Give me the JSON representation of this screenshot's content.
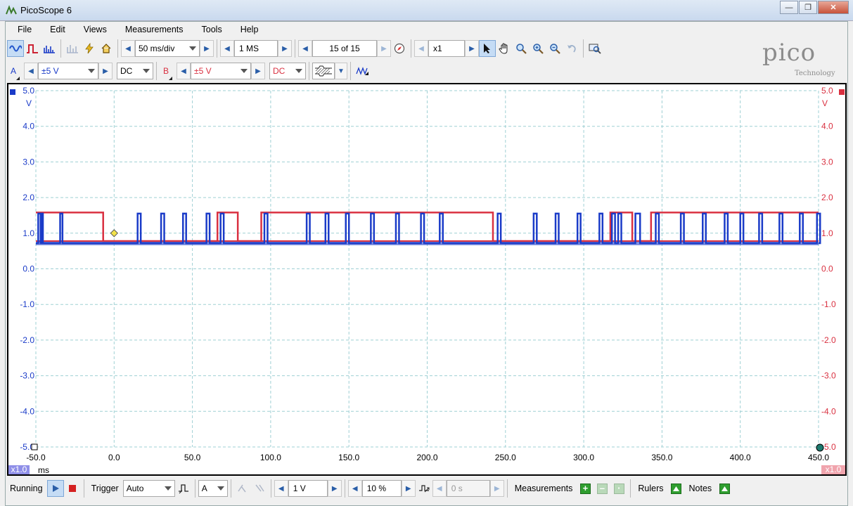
{
  "window": {
    "title": "PicoScope 6"
  },
  "menu": [
    "File",
    "Edit",
    "Views",
    "Measurements",
    "Tools",
    "Help"
  ],
  "toolbar": {
    "timebase": "50 ms/div",
    "samples": "1 MS",
    "buffer": "15 of 15",
    "zoom": "x1"
  },
  "channels": {
    "a": {
      "label": "A",
      "range": "±5 V",
      "coupling": "DC",
      "color": "#1a3bc8"
    },
    "b": {
      "label": "B",
      "range": "±5 V",
      "coupling": "DC",
      "color": "#d93040"
    }
  },
  "logo": {
    "brand": "pico",
    "tagline": "Technology"
  },
  "scope": {
    "y_ticks_left": [
      "5.0",
      "4.0",
      "3.0",
      "2.0",
      "1.0",
      "0.0",
      "-1.0",
      "-2.0",
      "-3.0",
      "-4.0",
      "-5.0"
    ],
    "y_ticks_right": [
      "5.0",
      "4.0",
      "3.0",
      "2.0",
      "1.0",
      "0.0",
      "-1.0",
      "-2.0",
      "-3.0",
      "-4.0",
      "-5.0"
    ],
    "y_unit_left": "V",
    "y_unit_right": "V",
    "x_ticks": [
      "-50.0",
      "0.0",
      "50.0",
      "100.0",
      "150.0",
      "200.0",
      "250.0",
      "300.0",
      "350.0",
      "400.0",
      "450.0"
    ],
    "x_unit": "ms",
    "x_scale_badge": "x1.0",
    "right_scale_badge": "x1.0"
  },
  "chart_data": {
    "type": "line",
    "xlabel": "ms",
    "ylabel": "V",
    "xlim": [
      -50,
      450
    ],
    "ylim": [
      -5,
      5
    ],
    "grid": true,
    "series": [
      {
        "name": "A",
        "color": "#1a3bc8",
        "low": 0.72,
        "high": 1.55,
        "pulses": [
          [
            -48.5,
            -47
          ],
          [
            -46,
            -45.5
          ],
          [
            -34.5,
            -33
          ],
          [
            15,
            17
          ],
          [
            30,
            32
          ],
          [
            44,
            46
          ],
          [
            59,
            61
          ],
          [
            68,
            70
          ],
          [
            96,
            98
          ],
          [
            123,
            125
          ],
          [
            135,
            137
          ],
          [
            148,
            150
          ],
          [
            164,
            166
          ],
          [
            180,
            182
          ],
          [
            196,
            198
          ],
          [
            208,
            210
          ],
          [
            245,
            247
          ],
          [
            268,
            270
          ],
          [
            282,
            284
          ],
          [
            296,
            298
          ],
          [
            310,
            312
          ],
          [
            318,
            320
          ],
          [
            322,
            324
          ],
          [
            333,
            336
          ],
          [
            346,
            348
          ],
          [
            362,
            364
          ],
          [
            376,
            378
          ],
          [
            390,
            392
          ],
          [
            400,
            402
          ],
          [
            412,
            414
          ],
          [
            425,
            427
          ],
          [
            438,
            440
          ],
          [
            449,
            451
          ]
        ]
      },
      {
        "name": "B",
        "color": "#d93040",
        "low": 0.78,
        "high": 1.58,
        "high_segments": [
          [
            -50,
            -7
          ],
          [
            66,
            79
          ],
          [
            94,
            242
          ],
          [
            317,
            331
          ],
          [
            343,
            450
          ]
        ]
      }
    ],
    "trigger": {
      "x": 0,
      "y": 1.0
    }
  },
  "status": {
    "run_label": "Running",
    "trigger_label": "Trigger",
    "trigger_mode": "Auto",
    "trigger_channel": "A",
    "threshold": "1 V",
    "pretrigger": "10 %",
    "delay": "0 s",
    "measurements_label": "Measurements",
    "rulers_label": "Rulers",
    "notes_label": "Notes"
  }
}
